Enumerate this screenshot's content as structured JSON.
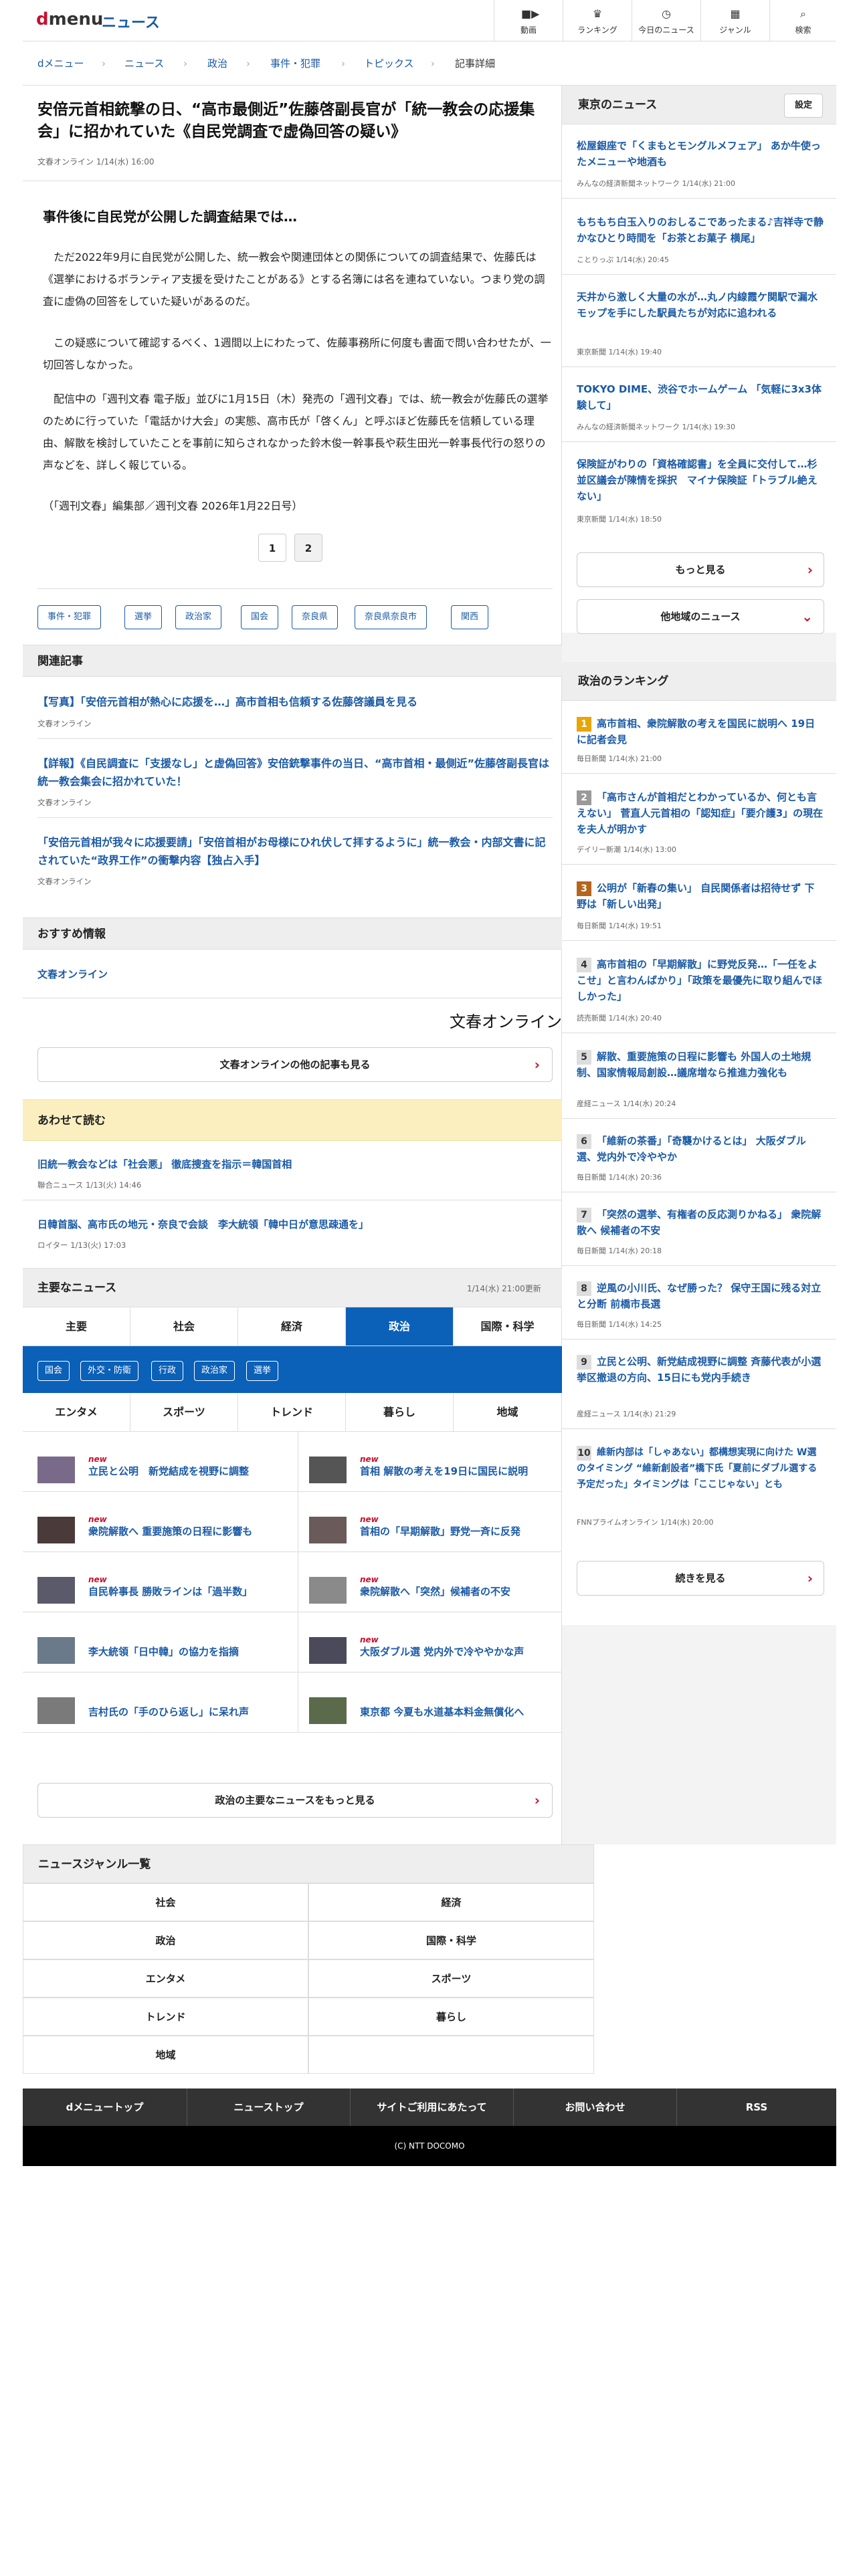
{
  "header": {
    "logo_d": "d",
    "logo_menu": "menu",
    "logo_news": "ニュース",
    "nav": [
      {
        "label": "動画",
        "icon": "video-icon"
      },
      {
        "label": "ランキング",
        "icon": "trophy-icon"
      },
      {
        "label": "今日のニュース",
        "icon": "clock-icon"
      },
      {
        "label": "ジャンル",
        "icon": "grid-icon"
      },
      {
        "label": "検索",
        "icon": "search-icon"
      }
    ]
  },
  "breadcrumb": [
    "dメニュー",
    "ニュース",
    "政治",
    "事件・犯罪",
    "トピックス",
    "記事詳細"
  ],
  "article": {
    "title": "安倍元首相銃撃の日、“高市最側近”佐藤啓副長官が「統一教会の応援集会」に招かれていた《自民党調査で虚偽回答の疑い》",
    "meta": "文春オンライン 1/14(水) 16:00",
    "subheading": "事件後に自民党が公開した調査結果では…",
    "paragraphs": [
      "　ただ2022年9月に自民党が公開した、統一教会や関連団体との関係についての調査結果で、佐藤氏は《選挙におけるボランティア支援を受けたことがある》とする名簿には名を連ねていない。つまり党の調査に虚偽の回答をしていた疑いがあるのだ。",
      "　この疑惑について確認するべく、1週間以上にわたって、佐藤事務所に何度も書面で問い合わせたが、一切回答しなかった。",
      "　配信中の「週刊文春 電子版」並びに1月15日（木）発売の「週刊文春」では、統一教会が佐藤氏の選挙のために行っていた「電話かけ大会」の実態、高市氏が「啓くん」と呼ぶほど佐藤氏を信頼している理由、解散を検討していたことを事前に知らされなかった鈴木俊一幹事長や萩生田光一幹事長代行の怒りの声などを、詳しく報じている。",
      "（「週刊文春」編集部／週刊文春 2026年1月22日号）"
    ],
    "pages": [
      "1",
      "2"
    ],
    "tags": [
      "事件・犯罪",
      "選挙",
      "政治家",
      "国会",
      "奈良県",
      "奈良県奈良市",
      "関西"
    ]
  },
  "related": {
    "heading": "関連記事",
    "items": [
      {
        "title": "【写真】「安倍元首相が熱心に応援を…」高市首相も信頼する佐藤啓議員を見る",
        "source": "文春オンライン"
      },
      {
        "title": "【詳報】《自民調査に「支援なし」と虚偽回答》安倍銃撃事件の当日、“高市首相・最側近”佐藤啓副長官は統一教会集会に招かれていた！",
        "source": "文春オンライン"
      },
      {
        "title": "「安倍元首相が我々に応援要請」「安倍首相がお母様にひれ伏して拝するように」統一教会・内部文書に記されていた“政界工作”の衝撃内容【独占入手】",
        "source": "文春オンライン"
      }
    ]
  },
  "recommend": {
    "heading": "おすすめ情報",
    "link": "文春オンライン",
    "logo_text": "文春オンライン",
    "more_button": "文春オンラインの他の記事も見る"
  },
  "also_read": {
    "heading": "あわせて読む",
    "items": [
      {
        "title": "旧統一教会などは「社会悪」 徹底捜査を指示＝韓国首相",
        "source": "聯合ニュース 1/13(火) 14:46"
      },
      {
        "title": "日韓首脳、高市氏の地元・奈良で会談　李大統領「韓中日が意思疎通を」",
        "source": "ロイター 1/13(火) 17:03"
      }
    ]
  },
  "major_news": {
    "heading": "主要なニュース",
    "updated": "1/14(水) 21:00更新",
    "tabs1": [
      "主要",
      "社会",
      "経済",
      "政治",
      "国際・科学"
    ],
    "active_tab": "政治",
    "subtabs": [
      "国会",
      "外交・防衛",
      "行政",
      "政治家",
      "選挙"
    ],
    "tabs2": [
      "エンタメ",
      "スポーツ",
      "トレンド",
      "暮らし",
      "地域"
    ],
    "new_label": "new",
    "items": [
      {
        "title": "立民と公明　新党結成を視野に調整",
        "new": true
      },
      {
        "title": "首相 解散の考えを19日に国民に説明",
        "new": true
      },
      {
        "title": "衆院解散へ 重要施策の日程に影響も",
        "new": true
      },
      {
        "title": "首相の「早期解散」野党一斉に反発",
        "new": true
      },
      {
        "title": "自民幹事長 勝敗ラインは「過半数」",
        "new": true
      },
      {
        "title": "衆院解散へ「突然」候補者の不安",
        "new": true
      },
      {
        "title": "李大統領「日中韓」の協力を指摘",
        "new": false
      },
      {
        "title": "大阪ダブル選 党内外で冷ややかな声",
        "new": true
      },
      {
        "title": "吉村氏の「手のひら返し」に呆れ声",
        "new": false
      },
      {
        "title": "東京都 今夏も水道基本料金無償化へ",
        "new": false
      }
    ],
    "more_button": "政治の主要なニュースをもっと見る"
  },
  "genre": {
    "heading": "ニュースジャンル一覧",
    "items": [
      "社会",
      "経済",
      "政治",
      "国際・科学",
      "エンタメ",
      "スポーツ",
      "トレンド",
      "暮らし",
      "地域"
    ]
  },
  "footer": {
    "links": [
      "dメニュートップ",
      "ニューストップ",
      "サイトご利用にあたって",
      "お問い合わせ",
      "RSS"
    ],
    "copyright": "(C) NTT DOCOMO"
  },
  "side": {
    "local_heading": "東京のニュース",
    "settings_button": "設定",
    "local_news": [
      {
        "title": "松屋銀座で「くまもとモングルメフェア」 あか牛使ったメニューや地酒も",
        "source": "みんなの経済新聞ネットワーク 1/14(水) 21:00"
      },
      {
        "title": "もちもち白玉入りのおしるこであったまる♪吉祥寺で静かなひとり時間を「お茶とお菓子 横尾」",
        "source": "ことりっぷ 1/14(水) 20:45"
      },
      {
        "title": "天井から激しく大量の水が…丸ノ内線霞ケ関駅で漏水　モップを手にした駅員たちが対応に追われる",
        "source": "東京新聞 1/14(水) 19:40"
      },
      {
        "title": "TOKYO DIME、渋谷でホームゲーム 「気軽に3x3体験して」",
        "source": "みんなの経済新聞ネットワーク 1/14(水) 19:30"
      },
      {
        "title": "保険証がわりの「資格確認書」を全員に交付して…杉並区議会が陳情を採択　マイナ保険証「トラブル絶えない」",
        "source": "東京新聞 1/14(水) 18:50"
      }
    ],
    "more_button": "もっと見る",
    "other_region_button": "他地域のニュース",
    "ranking_heading": "政治のランキング",
    "ranking": [
      {
        "rank": "1",
        "title": "高市首相、衆院解散の考えを国民に説明へ 19日に記者会見",
        "source": "毎日新聞 1/14(水) 21:00"
      },
      {
        "rank": "2",
        "title": "「高市さんが首相だとわかっているか、何とも言えない」 菅直人元首相の「認知症」「要介護3」の現在を夫人が明かす",
        "source": "デイリー新潮 1/14(水) 13:00"
      },
      {
        "rank": "3",
        "title": "公明が「新春の集い」 自民関係者は招待せず 下野は「新しい出発」",
        "source": "毎日新聞 1/14(水) 19:51"
      },
      {
        "rank": "4",
        "title": "高市首相の「早期解散」に野党反発…「一任をよこせ」と言わんばかり」「政策を最優先に取り組んでほしかった」",
        "source": "読売新聞 1/14(水) 20:40"
      },
      {
        "rank": "5",
        "title": "解散、重要施策の日程に影響も 外国人の土地規制、国家情報局創設…議席増なら推進力強化も",
        "source": "産経ニュース 1/14(水) 20:24"
      },
      {
        "rank": "6",
        "title": "「維新の茶番」「奇襲かけるとは」 大阪ダブル選、党内外で冷ややか",
        "source": "毎日新聞 1/14(水) 20:36"
      },
      {
        "rank": "7",
        "title": "「突然の選挙、有権者の反応測りかねる」 衆院解散へ 候補者の不安",
        "source": "毎日新聞 1/14(水) 20:18"
      },
      {
        "rank": "8",
        "title": "逆風の小川氏、なぜ勝った？ 保守王国に残る対立と分断 前橋市長選",
        "source": "毎日新聞 1/14(水) 14:25"
      },
      {
        "rank": "9",
        "title": "立民と公明、新党結成視野に調整 斉藤代表が小選挙区撤退の方向、15日にも党内手続き",
        "source": "産経ニュース 1/14(水) 21:29"
      },
      {
        "rank": "10",
        "title": "維新内部は「しゃあない」都構想実現に向けた W選のタイミング “維新創設者”橋下氏「夏前にダブル選する予定だった」タイミングは「ここじゃない」とも",
        "source": "FNNプライムオンライン 1/14(水) 20:00"
      }
    ],
    "ranking_more_button": "続きを見る"
  },
  "colors": {
    "brand_red": "#c8102e",
    "link_blue": "#1a5aa6",
    "tab_blue": "#0b60b8",
    "also_read_bg": "#fbefbf"
  }
}
